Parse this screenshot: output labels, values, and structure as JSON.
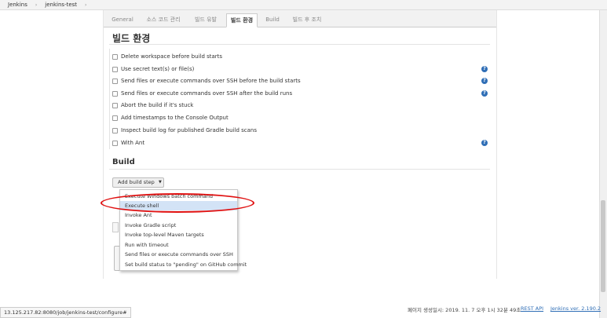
{
  "breadcrumb": [
    "Jenkins",
    "jenkins-test"
  ],
  "breadcrumb_sep": "›",
  "tabs": [
    {
      "label": "General",
      "active": false
    },
    {
      "label": "소스 코드 관리",
      "active": false
    },
    {
      "label": "빌드 유발",
      "active": false
    },
    {
      "label": "빌드 환경",
      "active": true
    },
    {
      "label": "Build",
      "active": false
    },
    {
      "label": "빌드 후 조치",
      "active": false
    }
  ],
  "build_env": {
    "title": "빌드 환경",
    "options": [
      {
        "label": "Delete workspace before build starts",
        "checked": false,
        "help": false
      },
      {
        "label": "Use secret text(s) or file(s)",
        "checked": false,
        "help": true
      },
      {
        "label": "Send files or execute commands over SSH before the build starts",
        "checked": false,
        "help": true
      },
      {
        "label": "Send files or execute commands over SSH after the build runs",
        "checked": false,
        "help": true
      },
      {
        "label": "Abort the build if it's stuck",
        "checked": false,
        "help": false
      },
      {
        "label": "Add timestamps to the Console Output",
        "checked": false,
        "help": false
      },
      {
        "label": "Inspect build log for published Gradle build scans",
        "checked": false,
        "help": false
      },
      {
        "label": "With Ant",
        "checked": false,
        "help": true
      }
    ]
  },
  "build": {
    "title": "Build",
    "add_step_label": "Add build step",
    "dropdown": [
      {
        "label": "Execute Windows batch command",
        "highlighted": false
      },
      {
        "label": "Execute shell",
        "highlighted": true
      },
      {
        "label": "Invoke Ant",
        "highlighted": false
      },
      {
        "label": "Invoke Gradle script",
        "highlighted": false
      },
      {
        "label": "Invoke top-level Maven targets",
        "highlighted": false
      },
      {
        "label": "Run with timeout",
        "highlighted": false
      },
      {
        "label": "Send files or execute commands over SSH",
        "highlighted": false
      },
      {
        "label": "Set build status to \"pending\" on GitHub commit",
        "highlighted": false
      }
    ]
  },
  "footer": {
    "generated": "페이지 생성일시: 2019. 11. 7 오후 1시 32분 49초",
    "rest_api": "REST API",
    "version": "Jenkins ver. 2.190.2"
  },
  "status_url": "13.125.217.82:8080/job/jenkins-test/configure#",
  "colors": {
    "link": "#2f6eb6",
    "highlight_row": "#d3e3f6",
    "annotation": "#e01010"
  }
}
